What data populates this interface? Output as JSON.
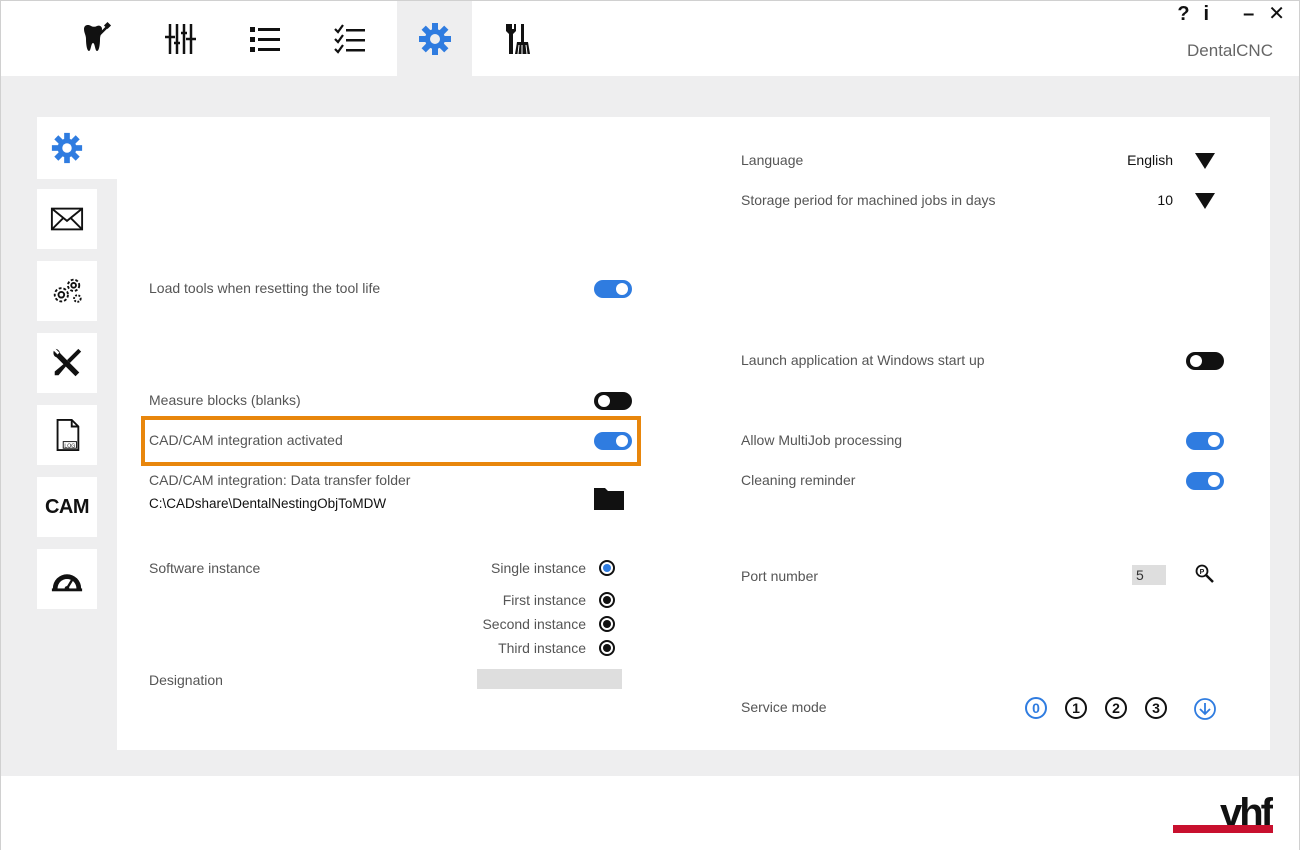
{
  "app": {
    "title": "DentalCNC"
  },
  "window_controls": {
    "help": "?",
    "info": "i",
    "minimize": "–",
    "close": "✕"
  },
  "top_tabs": [
    {
      "name": "tooth-icon",
      "active": false
    },
    {
      "name": "sliders-icon",
      "active": false
    },
    {
      "name": "list-icon",
      "active": false
    },
    {
      "name": "checklist-icon",
      "active": false
    },
    {
      "name": "gear-icon",
      "active": true
    },
    {
      "name": "tools-broom-icon",
      "active": false
    }
  ],
  "sidebar": {
    "items": [
      {
        "name": "gear-icon",
        "active": true
      },
      {
        "name": "envelope-icon",
        "active": false
      },
      {
        "name": "gears-icon",
        "active": false
      },
      {
        "name": "wrench-screwdriver-icon",
        "active": false
      },
      {
        "name": "log-file-icon",
        "active": false
      },
      {
        "name": "cam",
        "label": "CAM",
        "active": false
      },
      {
        "name": "gauge-icon",
        "active": false
      }
    ]
  },
  "settings": {
    "load_tools": {
      "label": "Load tools when resetting the tool life",
      "on": true
    },
    "measure_blocks": {
      "label": "Measure blocks (blanks)",
      "on": false
    },
    "cadcam_activated": {
      "label": "CAD/CAM integration activated",
      "on": true
    },
    "cadcam_folder": {
      "label": "CAD/CAM integration: Data transfer folder",
      "value": "C:\\CADshare\\DentalNestingObjToMDW"
    },
    "software_instance": {
      "label": "Software instance",
      "options": [
        {
          "label": "Single instance",
          "selected": true
        },
        {
          "label": "First instance",
          "selected": false
        },
        {
          "label": "Second instance",
          "selected": false
        },
        {
          "label": "Third instance",
          "selected": false
        }
      ]
    },
    "designation": {
      "label": "Designation",
      "value": ""
    },
    "language": {
      "label": "Language",
      "value": "English"
    },
    "storage_period": {
      "label": "Storage period for machined jobs in days",
      "value": "10"
    },
    "launch_startup": {
      "label": "Launch application at Windows start up",
      "on": false
    },
    "multijob": {
      "label": "Allow MultiJob processing",
      "on": true
    },
    "cleaning_reminder": {
      "label": "Cleaning reminder",
      "on": true
    },
    "port_number": {
      "label": "Port number",
      "value": "5"
    },
    "service_mode": {
      "label": "Service mode",
      "levels": [
        "0",
        "1",
        "2",
        "3"
      ],
      "active_level": "0"
    }
  },
  "colors": {
    "accent": "#2f7ce0",
    "highlight": "#e8860c",
    "brand_red": "#c8102e"
  },
  "brand": {
    "logo_text": "vhf"
  }
}
